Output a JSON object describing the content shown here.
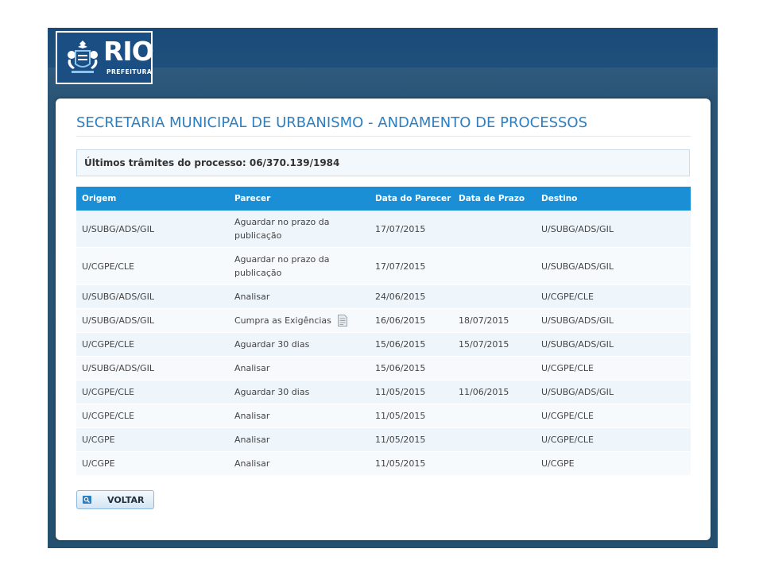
{
  "header": {
    "logo_title": "RIO",
    "logo_subtitle": "PREFEITURA"
  },
  "page": {
    "title": "SECRETARIA MUNICIPAL DE URBANISMO - ANDAMENTO DE PROCESSOS",
    "info": "Últimos trâmites do processo: 06/370.139/1984"
  },
  "table": {
    "headers": {
      "origem": "Origem",
      "parecer": "Parecer",
      "data_parecer": "Data do Parecer",
      "data_prazo": "Data de Prazo",
      "destino": "Destino"
    },
    "rows": [
      {
        "origem": "U/SUBG/ADS/GIL",
        "parecer": "Aguardar no prazo da publicação",
        "data_parecer": "17/07/2015",
        "data_prazo": "",
        "destino": "U/SUBG/ADS/GIL"
      },
      {
        "origem": "U/CGPE/CLE",
        "parecer": "Aguardar no prazo da publicação",
        "data_parecer": "17/07/2015",
        "data_prazo": "",
        "destino": "U/SUBG/ADS/GIL"
      },
      {
        "origem": "U/SUBG/ADS/GIL",
        "parecer": "Analisar",
        "data_parecer": "24/06/2015",
        "data_prazo": "",
        "destino": "U/CGPE/CLE"
      },
      {
        "origem": "U/SUBG/ADS/GIL",
        "parecer": "Cumpra as Exigências",
        "data_parecer": "16/06/2015",
        "data_prazo": "18/07/2015",
        "destino": "U/SUBG/ADS/GIL",
        "icon": "document-icon"
      },
      {
        "origem": "U/CGPE/CLE",
        "parecer": "Aguardar 30 dias",
        "data_parecer": "15/06/2015",
        "data_prazo": "15/07/2015",
        "destino": "U/SUBG/ADS/GIL"
      },
      {
        "origem": "U/SUBG/ADS/GIL",
        "parecer": "Analisar",
        "data_parecer": "15/06/2015",
        "data_prazo": "",
        "destino": "U/CGPE/CLE"
      },
      {
        "origem": "U/CGPE/CLE",
        "parecer": "Aguardar 30 dias",
        "data_parecer": "11/05/2015",
        "data_prazo": "11/06/2015",
        "destino": "U/SUBG/ADS/GIL"
      },
      {
        "origem": "U/CGPE/CLE",
        "parecer": "Analisar",
        "data_parecer": "11/05/2015",
        "data_prazo": "",
        "destino": "U/CGPE/CLE"
      },
      {
        "origem": "U/CGPE",
        "parecer": "Analisar",
        "data_parecer": "11/05/2015",
        "data_prazo": "",
        "destino": "U/CGPE/CLE"
      },
      {
        "origem": "U/CGPE",
        "parecer": "Analisar",
        "data_parecer": "11/05/2015",
        "data_prazo": "",
        "destino": "U/CGPE"
      }
    ]
  },
  "actions": {
    "back_label": "VOLTAR",
    "back_icon": "search-icon"
  },
  "colors": {
    "title": "#2d7fc2",
    "table_header": "#1b8fd6",
    "frame": "#1d4a73"
  }
}
